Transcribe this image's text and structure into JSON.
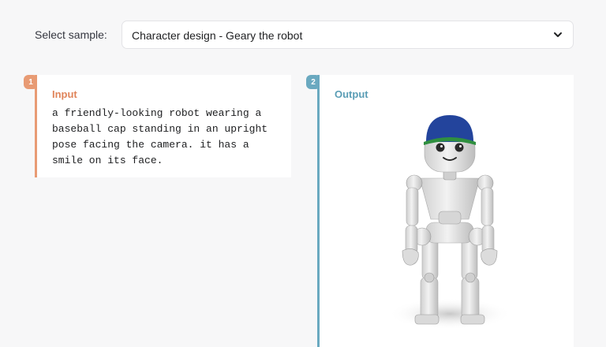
{
  "sample_selector": {
    "label": "Select sample:",
    "selected": "Character design - Geary the robot"
  },
  "input_card": {
    "step": "1",
    "title": "Input",
    "prompt": "a friendly-looking robot wearing a\nbaseball cap standing in an upright\npose facing the camera. it has a\nsmile on its face."
  },
  "output_card": {
    "step": "2",
    "title": "Output",
    "image_subject": "robot-render"
  },
  "colors": {
    "input_accent": "#e89b74",
    "output_accent": "#6aa9c0",
    "cap_blue": "#23449c",
    "cap_brim_green": "#2f8f3f",
    "robot_body": "#e6e6e6"
  }
}
